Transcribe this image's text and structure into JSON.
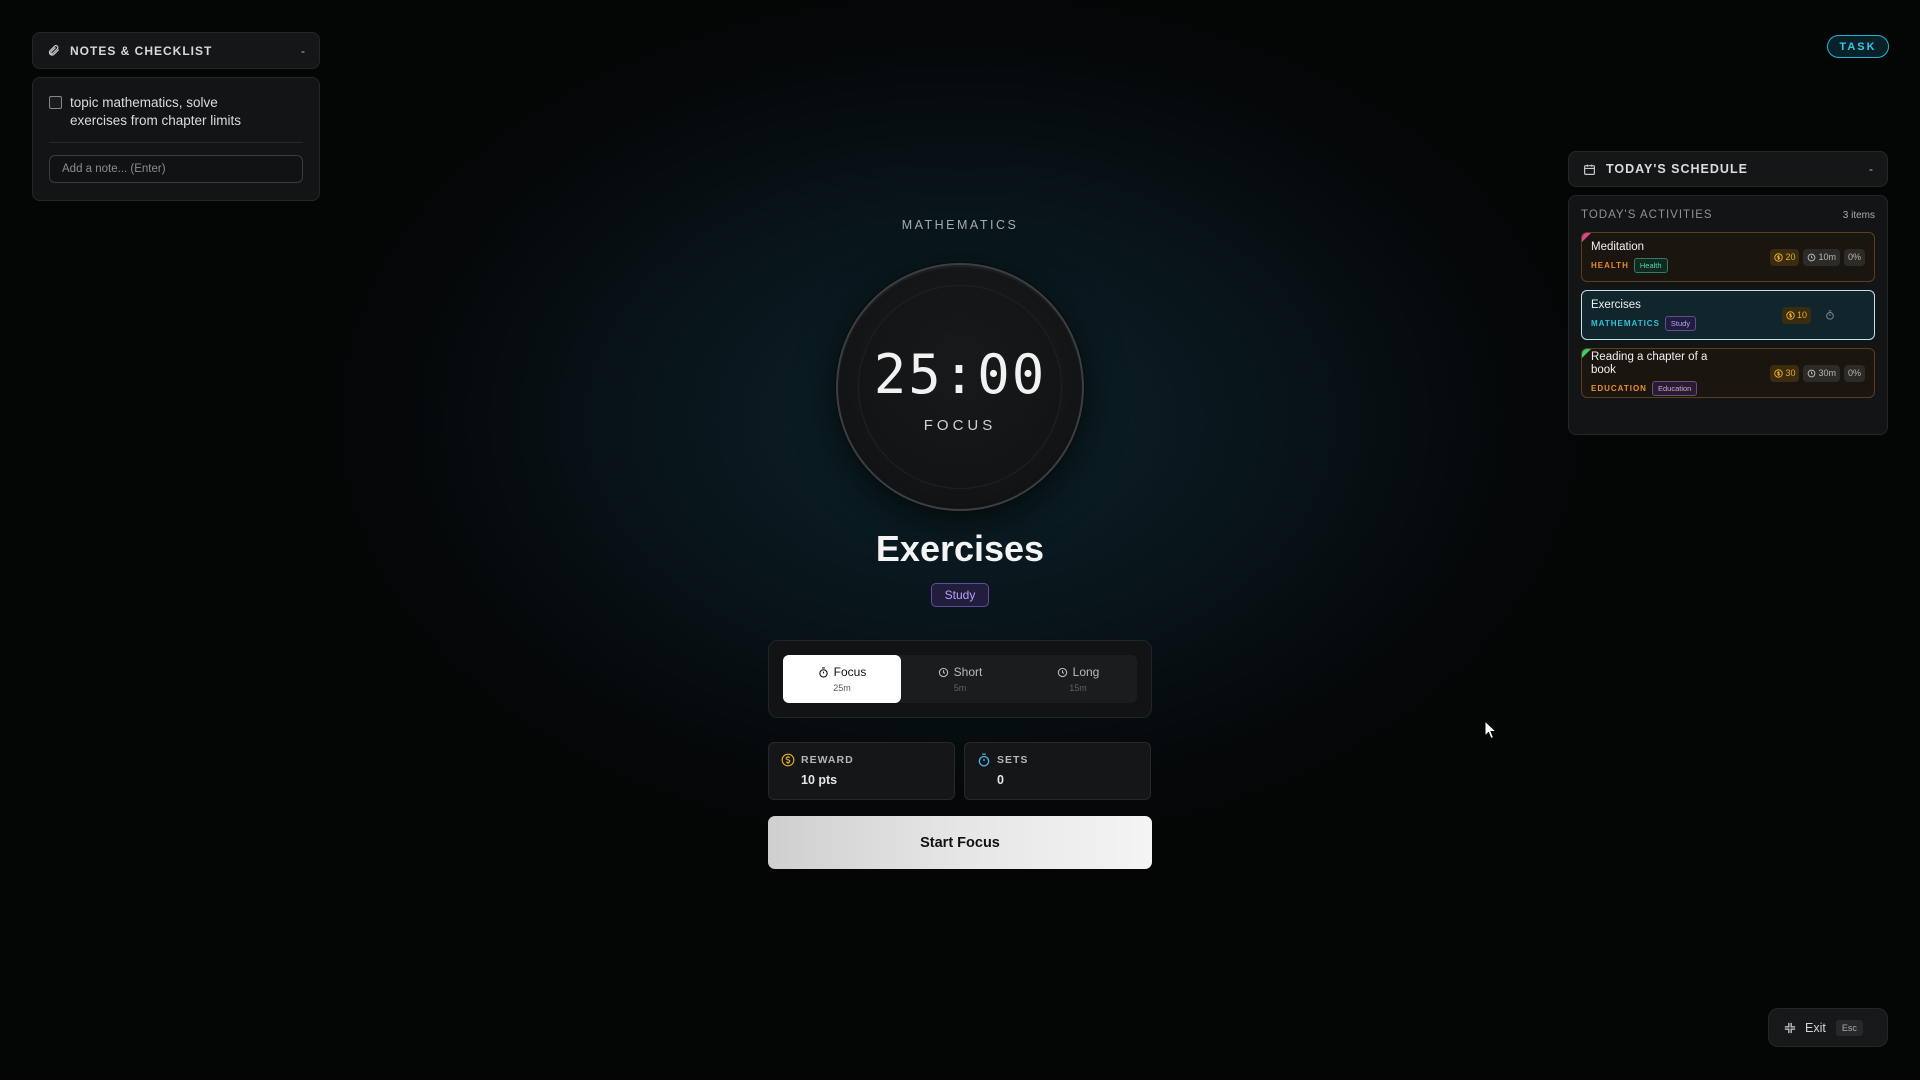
{
  "notes": {
    "title": "NOTES & CHECKLIST",
    "collapse": "-",
    "items": [
      {
        "text": "topic mathematics, solve exercises from chapter limits",
        "checked": false
      }
    ],
    "input_placeholder": "Add a note... (Enter)"
  },
  "task_button": "TASK",
  "timer": {
    "subject": "MATHEMATICS",
    "time": "25:00",
    "mode": "FOCUS",
    "task_title": "Exercises",
    "tag": "Study"
  },
  "modes": [
    {
      "label": "Focus",
      "duration": "25m",
      "active": true
    },
    {
      "label": "Short",
      "duration": "5m",
      "active": false
    },
    {
      "label": "Long",
      "duration": "15m",
      "active": false
    }
  ],
  "stats": {
    "reward": {
      "label": "REWARD",
      "value": "10 pts"
    },
    "sets": {
      "label": "SETS",
      "value": "0"
    }
  },
  "start_button": "Start Focus",
  "schedule": {
    "title": "TODAY'S SCHEDULE",
    "collapse": "-",
    "heading": "TODAY'S ACTIVITIES",
    "count": "3 items",
    "items": [
      {
        "name": "Meditation",
        "category": "HEALTH",
        "tag": "Health",
        "points": "20",
        "duration": "10m",
        "progress": "0%"
      },
      {
        "name": "Exercises",
        "category": "MATHEMATICS",
        "tag": "Study",
        "points": "10"
      },
      {
        "name": "Reading a chapter of a book",
        "category": "EDUCATION",
        "tag": "Education",
        "points": "30",
        "duration": "30m",
        "progress": "0%"
      }
    ]
  },
  "exit": {
    "label": "Exit",
    "key": "Esc"
  },
  "colors": {
    "accent_cyan": "#22b5d3",
    "health": "#e88a2e",
    "mathematics": "#33c0d9",
    "education": "#e8912e",
    "study_tag": "#b6a6f5",
    "points": "#e6a92a"
  }
}
